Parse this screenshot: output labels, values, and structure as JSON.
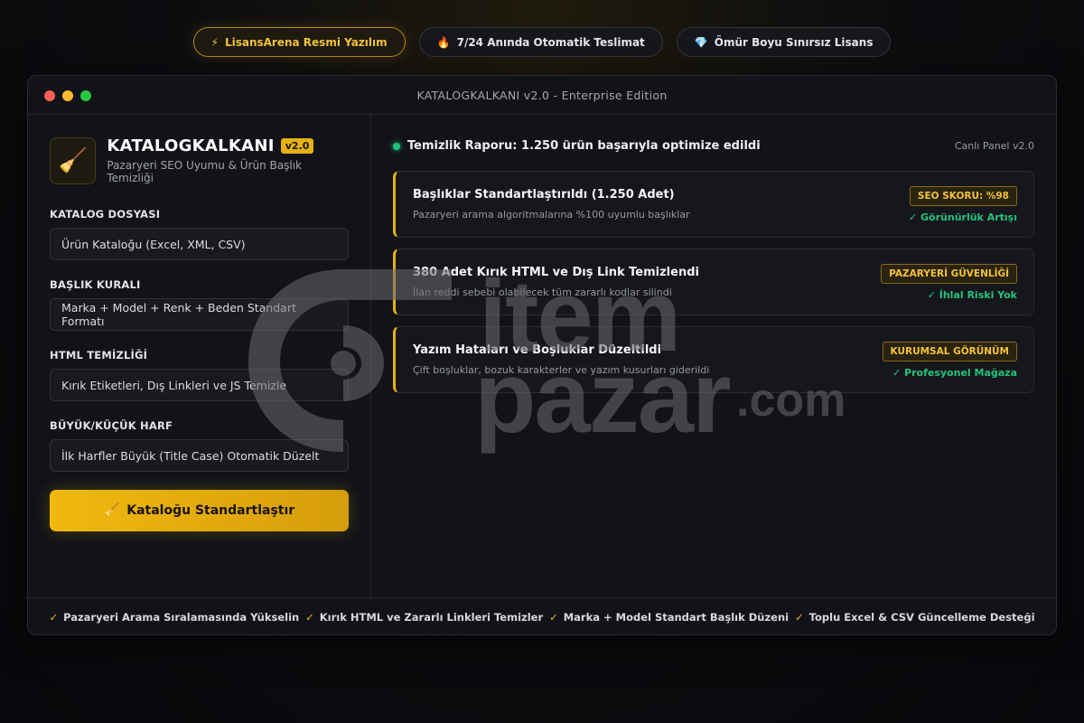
{
  "pills": [
    {
      "icon": "lightning-icon",
      "glyph": "⚡",
      "label": "LisansArena Resmi Yazılım"
    },
    {
      "icon": "fire-icon",
      "glyph": "🔥",
      "label": "7/24 Anında Otomatik Teslimat"
    },
    {
      "icon": "diamond-icon",
      "glyph": "💎",
      "label": "Ömür Boyu Sınırsız Lisans"
    }
  ],
  "window": {
    "title": "KATALOGKALKANI v2.0 - Enterprise Edition"
  },
  "brand": {
    "logo_glyph": "🧹",
    "name": "KATALOGKALKANI",
    "version": "v2.0",
    "subtitle": "Pazaryeri SEO Uyumu & Ürün Başlık Temizliği"
  },
  "form": {
    "fields": [
      {
        "label": "KATALOG DOSYASI",
        "value": "Ürün Kataloğu (Excel, XML, CSV)"
      },
      {
        "label": "BAŞLIK KURALI",
        "value": "Marka + Model + Renk + Beden Standart Formatı"
      },
      {
        "label": "HTML TEMİZLİĞİ",
        "value": "Kırık Etiketleri, Dış Linkleri ve JS Temizle"
      },
      {
        "label": "BÜYÜK/KÜÇÜK HARF",
        "value": "İlk Harfler Büyük (Title Case) Otomatik Düzelt"
      }
    ],
    "cta_glyph": "🧹",
    "cta_label": "Kataloğu Standartlaştır"
  },
  "report": {
    "title": "Temizlik Raporu: 1.250 ürün başarıyla optimize edildi",
    "panel_label": "Canlı Panel v2.0",
    "cards": [
      {
        "title": "Başlıklar Standartlaştırıldı (1.250 Adet)",
        "desc": "Pazaryeri arama algoritmalarına %100 uyumlu başlıklar",
        "tag": "SEO SKORU: %98",
        "status": "✓ Görünürlük Artışı"
      },
      {
        "title": "380 Adet Kırık HTML ve Dış Link Temizlendi",
        "desc": "İlan reddi sebebi olabilecek tüm zararlı kodlar silindi",
        "tag": "PAZARYERİ GÜVENLİĞİ",
        "status": "✓ İhlal Riski Yok"
      },
      {
        "title": "Yazım Hataları ve Boşluklar Düzeltildi",
        "desc": "Çift boşluklar, bozuk karakterler ve yazım kusurları giderildi",
        "tag": "KURUMSAL GÖRÜNÜM",
        "status": "✓ Profesyonel Mağaza"
      }
    ]
  },
  "footer": [
    {
      "check": "✓",
      "label": "Pazaryeri Arama Sıralamasında Yükselin"
    },
    {
      "check": "✓",
      "label": "Kırık HTML ve Zararlı Linkleri Temizler"
    },
    {
      "check": "✓",
      "label": "Marka + Model Standart Başlık Düzeni"
    },
    {
      "check": "✓",
      "label": "Toplu Excel & CSV Güncelleme Desteği"
    }
  ],
  "watermark": {
    "line1": "item",
    "line2": "pazar",
    "line3": ".com"
  },
  "colors": {
    "accent": "#f0b90e",
    "success": "#27c27d",
    "background": "#0d0d10",
    "window": "#111318"
  }
}
